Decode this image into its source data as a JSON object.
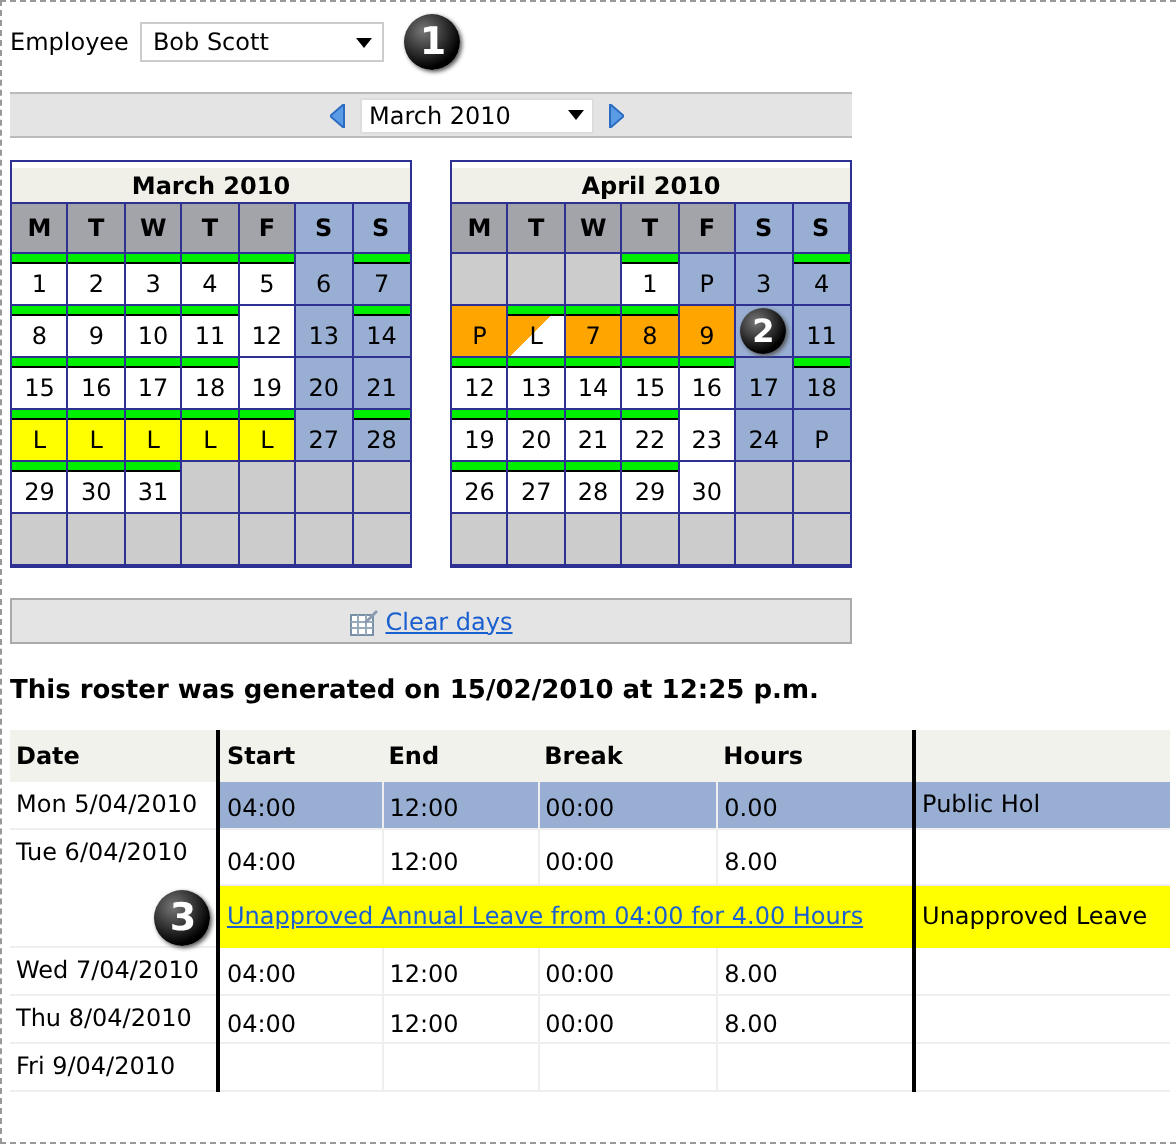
{
  "employee": {
    "label": "Employee",
    "value": "Bob Scott",
    "callout": "1"
  },
  "month_picker": {
    "value": "March 2010"
  },
  "calendars": [
    {
      "title": "March 2010",
      "weekdays": [
        {
          "label": "M",
          "weekend": false
        },
        {
          "label": "T",
          "weekend": false
        },
        {
          "label": "W",
          "weekend": false
        },
        {
          "label": "T",
          "weekend": false
        },
        {
          "label": "F",
          "weekend": false
        },
        {
          "label": "S",
          "weekend": true
        },
        {
          "label": "S",
          "weekend": true
        }
      ],
      "weeks": [
        [
          {
            "text": "1",
            "kind": "day",
            "shift": true
          },
          {
            "text": "2",
            "kind": "day",
            "shift": true
          },
          {
            "text": "3",
            "kind": "day",
            "shift": true
          },
          {
            "text": "4",
            "kind": "day",
            "shift": true
          },
          {
            "text": "5",
            "kind": "day",
            "shift": true
          },
          {
            "text": "6",
            "kind": "weekend",
            "shift": false
          },
          {
            "text": "7",
            "kind": "weekend",
            "shift": true
          }
        ],
        [
          {
            "text": "8",
            "kind": "day",
            "shift": true
          },
          {
            "text": "9",
            "kind": "day",
            "shift": true
          },
          {
            "text": "10",
            "kind": "day",
            "shift": true
          },
          {
            "text": "11",
            "kind": "day",
            "shift": true
          },
          {
            "text": "12",
            "kind": "day",
            "shift": false
          },
          {
            "text": "13",
            "kind": "weekend",
            "shift": false
          },
          {
            "text": "14",
            "kind": "weekend",
            "shift": true
          }
        ],
        [
          {
            "text": "15",
            "kind": "day",
            "shift": true
          },
          {
            "text": "16",
            "kind": "day",
            "shift": true
          },
          {
            "text": "17",
            "kind": "day",
            "shift": true
          },
          {
            "text": "18",
            "kind": "day",
            "shift": true
          },
          {
            "text": "19",
            "kind": "day",
            "shift": false
          },
          {
            "text": "20",
            "kind": "weekend",
            "shift": false
          },
          {
            "text": "21",
            "kind": "weekend",
            "shift": false
          }
        ],
        [
          {
            "text": "L",
            "kind": "leave",
            "shift": true
          },
          {
            "text": "L",
            "kind": "leave",
            "shift": true
          },
          {
            "text": "L",
            "kind": "leave",
            "shift": true
          },
          {
            "text": "L",
            "kind": "leave",
            "shift": true
          },
          {
            "text": "L",
            "kind": "leave",
            "shift": true
          },
          {
            "text": "27",
            "kind": "weekend",
            "shift": false
          },
          {
            "text": "28",
            "kind": "weekend",
            "shift": true
          }
        ],
        [
          {
            "text": "29",
            "kind": "day",
            "shift": true
          },
          {
            "text": "30",
            "kind": "day",
            "shift": true
          },
          {
            "text": "31",
            "kind": "day",
            "shift": true
          },
          {
            "kind": "empty",
            "shift": false
          },
          {
            "kind": "empty",
            "shift": false
          },
          {
            "kind": "empty",
            "shift": false
          },
          {
            "kind": "empty",
            "shift": false
          }
        ],
        [
          {
            "kind": "empty",
            "shift": false
          },
          {
            "kind": "empty",
            "shift": false
          },
          {
            "kind": "empty",
            "shift": false
          },
          {
            "kind": "empty",
            "shift": false
          },
          {
            "kind": "empty",
            "shift": false
          },
          {
            "kind": "empty",
            "shift": false
          },
          {
            "kind": "empty",
            "shift": false
          }
        ]
      ]
    },
    {
      "title": "April 2010",
      "weekdays": [
        {
          "label": "M",
          "weekend": false
        },
        {
          "label": "T",
          "weekend": false
        },
        {
          "label": "W",
          "weekend": false
        },
        {
          "label": "T",
          "weekend": false
        },
        {
          "label": "F",
          "weekend": false
        },
        {
          "label": "S",
          "weekend": true
        },
        {
          "label": "S",
          "weekend": true
        }
      ],
      "weeks": [
        [
          {
            "kind": "empty",
            "shift": false
          },
          {
            "kind": "empty",
            "shift": false
          },
          {
            "kind": "empty",
            "shift": false
          },
          {
            "text": "1",
            "kind": "day",
            "shift": true
          },
          {
            "text": "P",
            "kind": "weekend",
            "shift": false
          },
          {
            "text": "3",
            "kind": "weekend",
            "shift": false
          },
          {
            "text": "4",
            "kind": "weekend",
            "shift": true
          }
        ],
        [
          {
            "text": "P",
            "kind": "pending",
            "shift": false
          },
          {
            "text": "L",
            "kind": "pending_half",
            "shift": true
          },
          {
            "text": "7",
            "kind": "pending",
            "shift": true
          },
          {
            "text": "8",
            "kind": "pending",
            "shift": true
          },
          {
            "text": "9",
            "kind": "pending",
            "shift": false
          },
          {
            "kind": "weekend",
            "shift": false,
            "callout": "2"
          },
          {
            "text": "11",
            "kind": "weekend",
            "shift": false
          }
        ],
        [
          {
            "text": "12",
            "kind": "day",
            "shift": true
          },
          {
            "text": "13",
            "kind": "day",
            "shift": true
          },
          {
            "text": "14",
            "kind": "day",
            "shift": true
          },
          {
            "text": "15",
            "kind": "day",
            "shift": true
          },
          {
            "text": "16",
            "kind": "day",
            "shift": true
          },
          {
            "text": "17",
            "kind": "weekend",
            "shift": false
          },
          {
            "text": "18",
            "kind": "weekend",
            "shift": true
          }
        ],
        [
          {
            "text": "19",
            "kind": "day",
            "shift": true
          },
          {
            "text": "20",
            "kind": "day",
            "shift": true
          },
          {
            "text": "21",
            "kind": "day",
            "shift": true
          },
          {
            "text": "22",
            "kind": "day",
            "shift": true
          },
          {
            "text": "23",
            "kind": "day",
            "shift": false
          },
          {
            "text": "24",
            "kind": "weekend",
            "shift": false
          },
          {
            "text": "P",
            "kind": "weekend",
            "shift": false
          }
        ],
        [
          {
            "text": "26",
            "kind": "day",
            "shift": true
          },
          {
            "text": "27",
            "kind": "day",
            "shift": true
          },
          {
            "text": "28",
            "kind": "day",
            "shift": true
          },
          {
            "text": "29",
            "kind": "day",
            "shift": true
          },
          {
            "text": "30",
            "kind": "day",
            "shift": false
          },
          {
            "kind": "empty",
            "shift": false
          },
          {
            "kind": "empty",
            "shift": false
          }
        ],
        [
          {
            "kind": "empty",
            "shift": false
          },
          {
            "kind": "empty",
            "shift": false
          },
          {
            "kind": "empty",
            "shift": false
          },
          {
            "kind": "empty",
            "shift": false
          },
          {
            "kind": "empty",
            "shift": false
          },
          {
            "kind": "empty",
            "shift": false
          },
          {
            "kind": "empty",
            "shift": false
          }
        ]
      ]
    }
  ],
  "clear_link": "Clear days",
  "generated_note": "This roster was generated on 15/02/2010 at 12:25 p.m.",
  "roster": {
    "columns": [
      "Date",
      "Start",
      "End",
      "Break",
      "Hours"
    ],
    "rows": [
      {
        "date": "Mon 5/04/2010",
        "highlighted": true,
        "cells": [
          "04:00",
          "12:00",
          "00:00",
          "0.00"
        ],
        "note": "Public Hol"
      },
      {
        "date": "Tue 6/04/2010",
        "highlighted": false,
        "cells": [
          "04:00",
          "12:00",
          "00:00",
          "8.00"
        ],
        "leave": {
          "link": "Unapproved Annual Leave from 04:00 for 4.00 Hours",
          "note": "Unapproved Leave",
          "callout": "3"
        }
      },
      {
        "date": "Wed 7/04/2010",
        "highlighted": false,
        "cells": [
          "04:00",
          "12:00",
          "00:00",
          "8.00"
        ]
      },
      {
        "date": "Thu 8/04/2010",
        "highlighted": false,
        "cells": [
          "04:00",
          "12:00",
          "00:00",
          "8.00"
        ]
      },
      {
        "date": "Fri 9/04/2010",
        "highlighted": false
      }
    ]
  }
}
